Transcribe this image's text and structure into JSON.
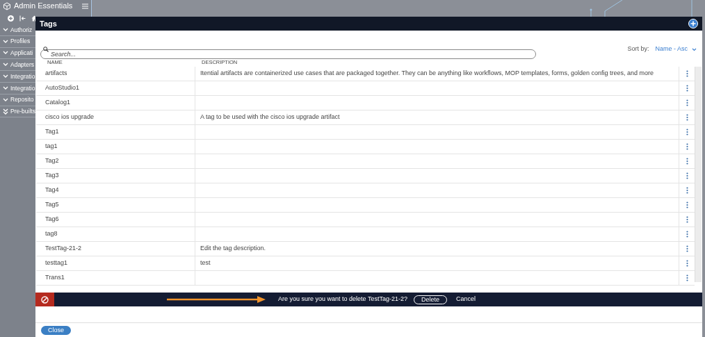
{
  "sidebar": {
    "title": "Admin Essentials",
    "items": [
      {
        "label": "Authoriz",
        "kind": "collapsible"
      },
      {
        "label": "Profiles",
        "kind": "collapsible"
      },
      {
        "label": "Applicati",
        "kind": "collapsible"
      },
      {
        "label": "Adapters",
        "kind": "collapsible"
      },
      {
        "label": "Integratio",
        "kind": "collapsible"
      },
      {
        "label": "Integratio",
        "kind": "collapsible"
      },
      {
        "label": "Reposito",
        "kind": "collapsible"
      },
      {
        "label": "Pre-builts",
        "kind": "expand-all"
      }
    ]
  },
  "dialog": {
    "title": "Tags",
    "search": {
      "placeholder": "Search..."
    },
    "sort": {
      "label": "Sort by:",
      "value": "Name - Asc"
    },
    "table": {
      "columns": [
        "NAME",
        "DESCRIPTION"
      ],
      "rows": [
        {
          "name": "artifacts",
          "description": "Itential artifacts are containerized use cases that are packaged together. They can be anything like workflows, MOP templates, forms, golden config trees, and more"
        },
        {
          "name": "AutoStudio1",
          "description": ""
        },
        {
          "name": "Catalog1",
          "description": ""
        },
        {
          "name": "cisco ios upgrade",
          "description": "A tag to be used with the cisco ios upgrade artifact"
        },
        {
          "name": "Tag1",
          "description": ""
        },
        {
          "name": "tag1",
          "description": ""
        },
        {
          "name": "Tag2",
          "description": ""
        },
        {
          "name": "Tag3",
          "description": ""
        },
        {
          "name": "Tag4",
          "description": ""
        },
        {
          "name": "Tag5",
          "description": ""
        },
        {
          "name": "Tag6",
          "description": ""
        },
        {
          "name": "tag8",
          "description": ""
        },
        {
          "name": "TestTag-21-2",
          "description": "Edit the tag description."
        },
        {
          "name": "testtag1",
          "description": "test"
        },
        {
          "name": "Trans1",
          "description": ""
        }
      ]
    },
    "confirm": {
      "message": "Are you sure you want to delete TestTag-21-2?",
      "confirm_button": "Delete",
      "cancel_button": "Cancel"
    },
    "close_button": "Close"
  }
}
